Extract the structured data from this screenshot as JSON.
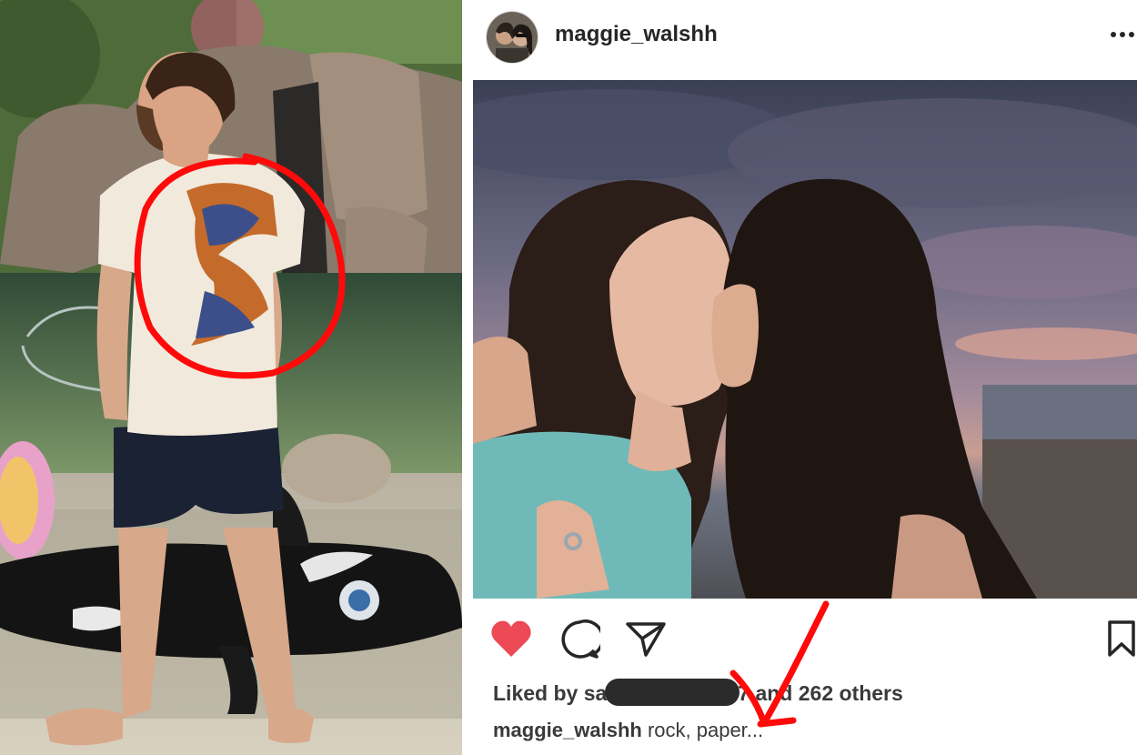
{
  "post": {
    "username": "maggie_walshh",
    "likes": {
      "prefix": "Liked by sa",
      "suffix": "7 and 262 others"
    },
    "caption": {
      "user": "maggie_walshh",
      "text": " rock, paper..."
    }
  },
  "icons": {
    "like": "heart-icon",
    "comment": "comment-bubble-icon",
    "share": "send-arrow-icon",
    "save": "bookmark-icon",
    "more": "more-dots-icon"
  },
  "colors": {
    "like_red": "#ed4956",
    "annotation_red": "#ff0a0a",
    "text_dark": "#262626"
  }
}
